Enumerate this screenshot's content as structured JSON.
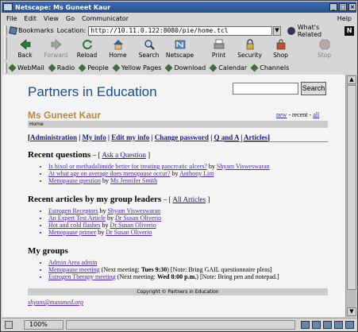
{
  "window": {
    "title": "Netscape: Ms Guneet Kaur"
  },
  "menubar": [
    "File",
    "Edit",
    "View",
    "Go",
    "Communicator",
    "Help"
  ],
  "location": {
    "bookmarks_label": "Bookmarks",
    "location_label": "Location:",
    "url": "http://10.11.0.122:8080/pie/home.tcl",
    "related_label": "What's Related"
  },
  "navbar": [
    {
      "label": "Back",
      "enabled": true
    },
    {
      "label": "Forward",
      "enabled": false
    },
    {
      "label": "Reload",
      "enabled": true
    },
    {
      "label": "Home",
      "enabled": true
    },
    {
      "label": "Search",
      "enabled": true
    },
    {
      "label": "Netscape",
      "enabled": true
    },
    {
      "label": "Print",
      "enabled": true
    },
    {
      "label": "Security",
      "enabled": true
    },
    {
      "label": "Shop",
      "enabled": true
    },
    {
      "label": "Stop",
      "enabled": false
    }
  ],
  "personal_toolbar": [
    "WebMail",
    "Radio",
    "People",
    "Yellow Pages",
    "Download",
    "Calendar",
    "Channels"
  ],
  "page": {
    "site_title": "Partners in Education",
    "search_button": "Search",
    "search_value": "",
    "user_name": "Ms Guneet Kaur",
    "new_link": "new",
    "sep1": " - recent - ",
    "all_link": "all",
    "crumb": "Home",
    "admin_links": [
      "Administration",
      "My info",
      "Edit my info",
      "Change password",
      "Q and A",
      "Articles"
    ],
    "questions": {
      "heading": "Recent questions",
      "action": "Ask a Question",
      "items": [
        {
          "title": "Is hixol or methadalimide better for treating pancreatic ulcers?",
          "by": "by",
          "author": "Shyam Visweswaran"
        },
        {
          "title": "At what age on average does menopause occur?",
          "by": "by",
          "author": "Anthony Lim"
        },
        {
          "title": "Menopause question",
          "by": "by",
          "author": "Ms Jennifer Smith"
        }
      ]
    },
    "articles": {
      "heading": "Recent articles by my group leaders",
      "action": "All Articles",
      "items": [
        {
          "title": "Estrogen Receptors",
          "by": "by",
          "author": "Shyam Visweswaran"
        },
        {
          "title": "An Expert Test Article",
          "by": "by",
          "author": "Dr Susan Oliverio"
        },
        {
          "title": "Hot and cold flashes",
          "by": "by",
          "author": "Dr Susan Oliverio"
        },
        {
          "title": "Menopause primer",
          "by": "by",
          "author": "Dr Susan Oliverio"
        }
      ]
    },
    "groups": {
      "heading": "My groups",
      "items": [
        {
          "name": "Admin Area admin",
          "meeting_prefix": "",
          "meeting_time": "",
          "note": ""
        },
        {
          "name": "Menopause meeting",
          "meeting_prefix": "(Next meeting: ",
          "meeting_time": "Tues 9:30",
          "note": ")   [Note: Bring GAIL questionnaire pleas]"
        },
        {
          "name": "Estrogen Therapy meeting",
          "meeting_prefix": "(Next meeting: ",
          "meeting_time": "Wed 8:00 p.m.",
          "note": ")   [Note: Bring pen and notepad.]"
        }
      ]
    },
    "footer": "Copyright © Partners in Education",
    "email": "shyam@massmed.org"
  },
  "status": {
    "zoom": "100%"
  }
}
